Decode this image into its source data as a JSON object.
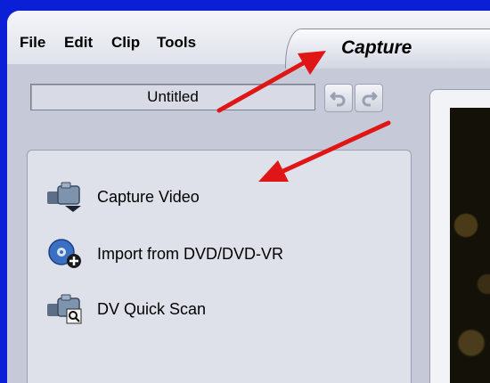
{
  "menu": {
    "items": [
      "File",
      "Edit",
      "Clip",
      "Tools"
    ]
  },
  "tabs": {
    "active_label": "Capture"
  },
  "project": {
    "title": "Untitled"
  },
  "toolbar": {
    "undo_icon": "undo-icon",
    "redo_icon": "redo-icon"
  },
  "capture_panel": {
    "items": [
      {
        "label": "Capture Video",
        "icon": "camcorder-capture-icon"
      },
      {
        "label": "Import from DVD/DVD-VR",
        "icon": "dvd-import-icon"
      },
      {
        "label": "DV Quick Scan",
        "icon": "camcorder-scan-icon"
      }
    ]
  },
  "annotations": {
    "arrow_color": "#e01515"
  },
  "colors": {
    "window_border": "#0a1fd6",
    "app_background": "#c6cad8"
  }
}
